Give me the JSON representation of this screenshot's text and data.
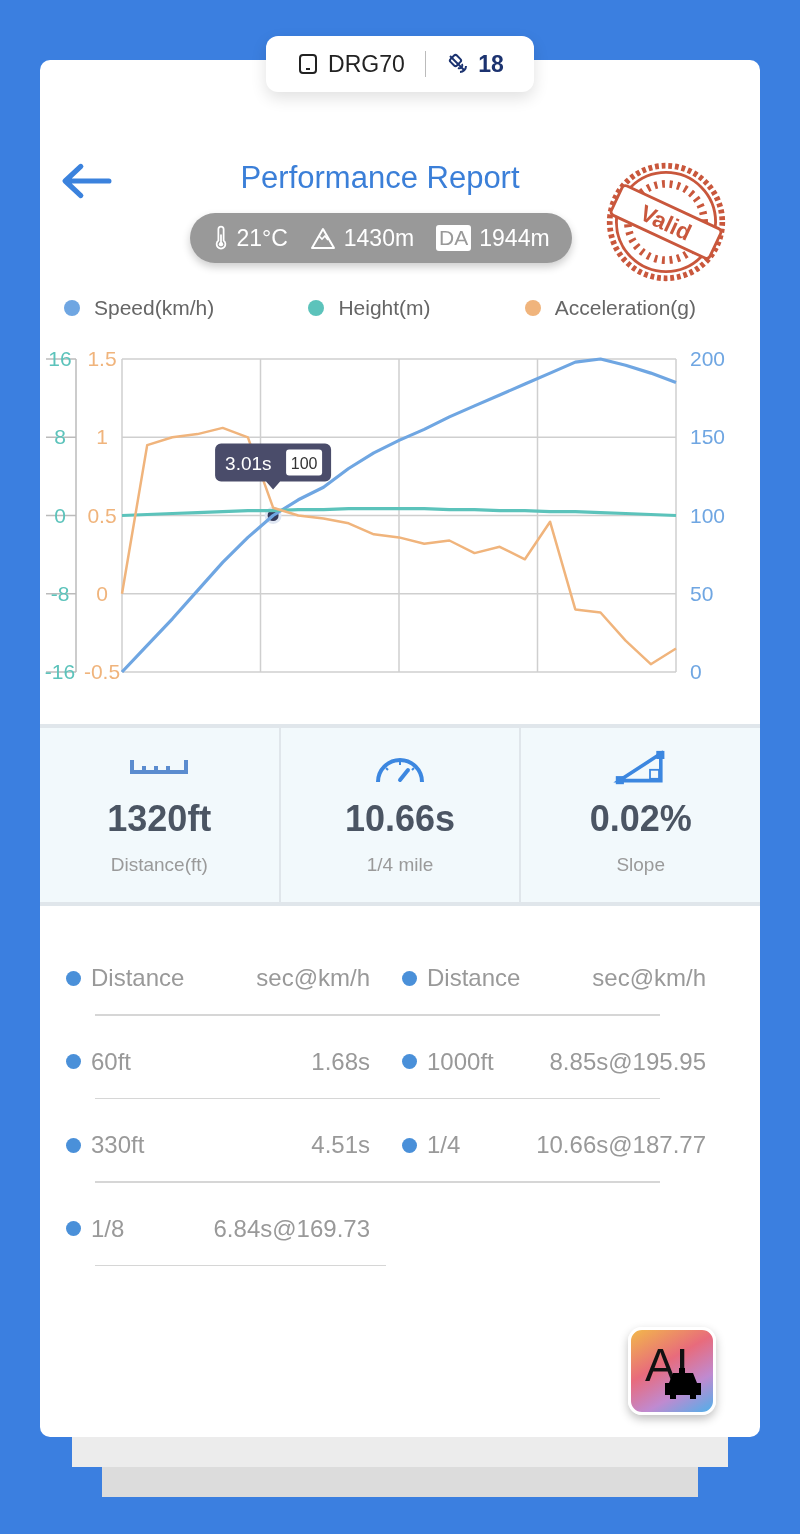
{
  "device": {
    "name": "DRG70",
    "satellites": "18"
  },
  "header": {
    "title": "Performance Report",
    "stamp": "Valid"
  },
  "conditions": {
    "temperature": "21°C",
    "altitude": "1430m",
    "da_badge": "DA",
    "density_altitude": "1944m"
  },
  "chart": {
    "panels": [
      {
        "chart_data": {
          "type": "line",
          "categories": [
            null,
            null,
            null,
            null,
            null,
            null,
            null,
            null,
            null,
            null,
            null,
            null,
            null,
            null,
            null,
            null,
            null,
            null,
            null,
            null,
            null,
            null,
            null
          ],
          "ylim": [
            0,
            200
          ],
          "yticks": [
            0,
            50,
            100,
            150,
            200
          ],
          "series": [
            {
              "name": "Speed(km/h)",
              "color": "#6fa6e2",
              "values": [
                0,
                17,
                34,
                52,
                70,
                86,
                100,
                110,
                118,
                130,
                140,
                148,
                155,
                163,
                170,
                177,
                184,
                191,
                198,
                200,
                196,
                191,
                185
              ]
            }
          ]
        }
      },
      {
        "chart_data": {
          "type": "line",
          "categories": [
            null,
            null,
            null,
            null,
            null,
            null,
            null,
            null,
            null,
            null,
            null,
            null,
            null,
            null,
            null,
            null,
            null,
            null,
            null,
            null,
            null,
            null,
            null
          ],
          "ylim": [
            -16,
            16
          ],
          "yticks": [
            -16,
            -8,
            0,
            8,
            16
          ],
          "series": [
            {
              "name": "Height(m)",
              "color": "#5cc3bb",
              "values": [
                0,
                0.1,
                0.2,
                0.3,
                0.4,
                0.5,
                0.5,
                0.6,
                0.6,
                0.7,
                0.7,
                0.7,
                0.7,
                0.6,
                0.6,
                0.5,
                0.5,
                0.4,
                0.4,
                0.3,
                0.2,
                0.1,
                0
              ]
            }
          ]
        }
      },
      {
        "chart_data": {
          "type": "line",
          "categories": [
            null,
            null,
            null,
            null,
            null,
            null,
            null,
            null,
            null,
            null,
            null,
            null,
            null,
            null,
            null,
            null,
            null,
            null,
            null,
            null,
            null,
            null,
            null
          ],
          "ylim": [
            -0.5,
            1.5
          ],
          "yticks": [
            -0.5,
            0,
            0.5,
            1,
            1.5
          ],
          "series": [
            {
              "name": "Acceleration(g)",
              "color": "#f0b47c",
              "values": [
                0,
                0.95,
                1.0,
                1.02,
                1.06,
                1.0,
                0.55,
                0.5,
                0.48,
                0.45,
                0.38,
                0.36,
                0.32,
                0.34,
                0.26,
                0.3,
                0.22,
                0.46,
                -0.1,
                -0.12,
                -0.3,
                -0.45,
                -0.35
              ]
            }
          ]
        }
      }
    ],
    "tooltip": {
      "time": "3.01s",
      "value": "100"
    }
  },
  "stats": [
    {
      "kind": "distance",
      "value": "1320ft",
      "label": "Distance(ft)"
    },
    {
      "kind": "time",
      "value": "10.66s",
      "label": "1/4 mile"
    },
    {
      "kind": "slope",
      "value": "0.02%",
      "label": "Slope"
    }
  ],
  "splits": {
    "header": [
      {
        "label": "Distance",
        "value": "sec@km/h"
      },
      {
        "label": "Distance",
        "value": "sec@km/h"
      }
    ],
    "rows": [
      [
        {
          "label": "60ft",
          "value": "1.68s"
        },
        {
          "label": "1000ft",
          "value": "8.85s@195.95"
        }
      ],
      [
        {
          "label": "330ft",
          "value": "4.51s"
        },
        {
          "label": "1/4",
          "value": "10.66s@187.77"
        }
      ],
      [
        {
          "label": "1/8",
          "value": "6.84s@169.73"
        }
      ]
    ]
  },
  "ai_button": {
    "label": "AI"
  }
}
